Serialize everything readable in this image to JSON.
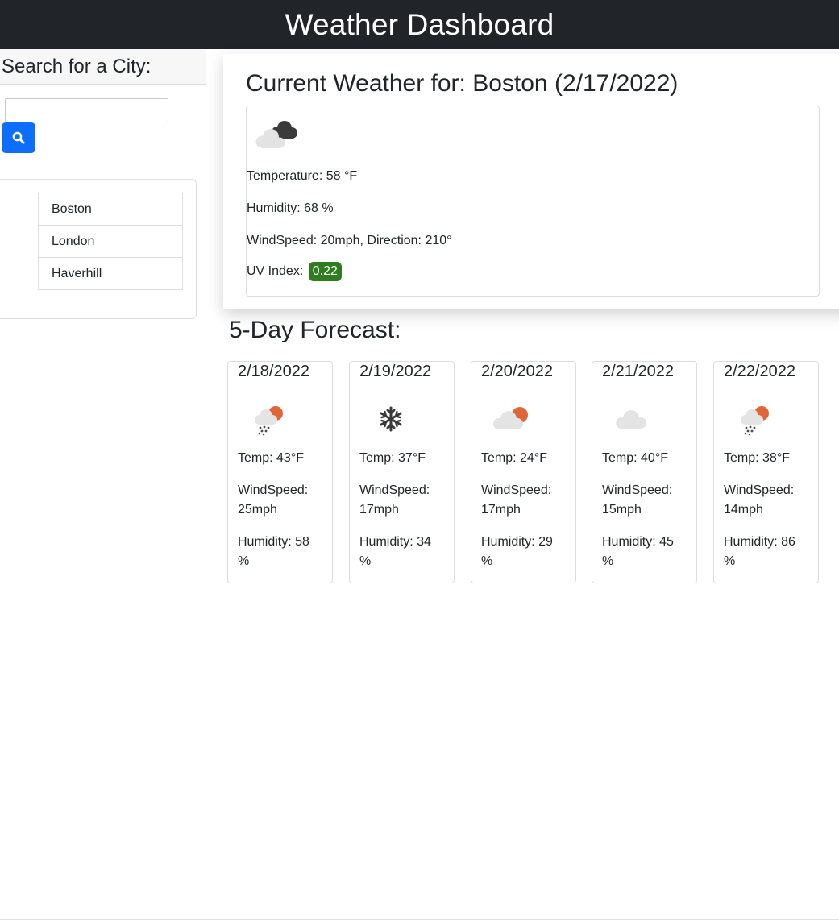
{
  "header": {
    "title": "Weather Dashboard"
  },
  "sidebar": {
    "title": "Search for a City:",
    "search": {
      "value": "",
      "placeholder": "",
      "button_icon": "search-icon",
      "button_color": "#0d6efd"
    },
    "history": [
      {
        "label": "Boston"
      },
      {
        "label": "London"
      },
      {
        "label": "Haverhill"
      }
    ]
  },
  "current": {
    "title": "Current Weather for: Boston (2/17/2022)",
    "icon": "broken-clouds-icon",
    "temperature": "Temperature: 58 °F",
    "humidity": "Humidity: 68 %",
    "wind": "WindSpeed: 20mph, Direction: 210°",
    "uv_label": "UV Index:",
    "uv_value": "0.22",
    "uv_color": "#2e7d1f"
  },
  "forecast": {
    "title": "5-Day Forecast:",
    "days": [
      {
        "date": "2/18/2022",
        "icon": "snow-sun-icon",
        "temp": "Temp: 43°F",
        "wind_label": "WindSpeed:",
        "wind_value": "25mph",
        "humidity_label": "Humidity: 58",
        "humidity_unit": "%"
      },
      {
        "date": "2/19/2022",
        "icon": "snowflake-icon",
        "temp": "Temp: 37°F",
        "wind_label": "WindSpeed:",
        "wind_value": "17mph",
        "humidity_label": "Humidity: 34",
        "humidity_unit": "%"
      },
      {
        "date": "2/20/2022",
        "icon": "cloud-sun-icon",
        "temp": "Temp: 24°F",
        "wind_label": "WindSpeed:",
        "wind_value": "17mph",
        "humidity_label": "Humidity: 29",
        "humidity_unit": "%"
      },
      {
        "date": "2/21/2022",
        "icon": "cloud-icon",
        "temp": "Temp: 40°F",
        "wind_label": "WindSpeed:",
        "wind_value": "15mph",
        "humidity_label": "Humidity: 45",
        "humidity_unit": "%"
      },
      {
        "date": "2/22/2022",
        "icon": "snow-sun-icon",
        "temp": "Temp: 38°F",
        "wind_label": "WindSpeed:",
        "wind_value": "14mph",
        "humidity_label": "Humidity: 86",
        "humidity_unit": "%"
      }
    ]
  }
}
